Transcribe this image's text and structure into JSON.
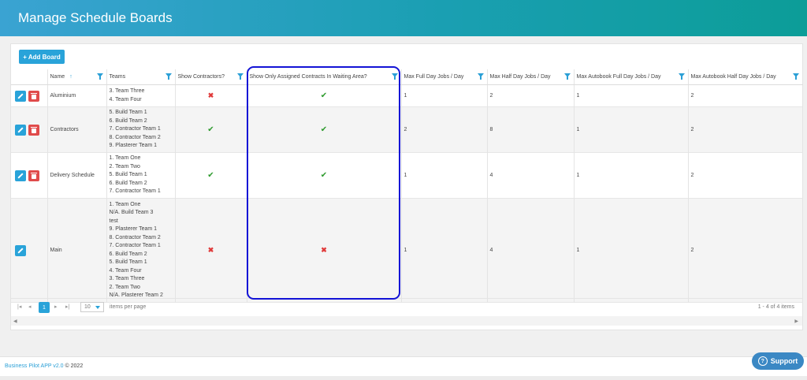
{
  "header": {
    "title": "Manage Schedule Boards"
  },
  "toolbar": {
    "add_board_label": "+ Add Board"
  },
  "columns": [
    {
      "label": ""
    },
    {
      "label": "Name",
      "sort": "↑"
    },
    {
      "label": "Teams"
    },
    {
      "label": "Show Contractors?"
    },
    {
      "label": "Show Only Assigned Contracts In Waiting Area?"
    },
    {
      "label": "Max Full Day Jobs / Day"
    },
    {
      "label": "Max Half Day Jobs / Day"
    },
    {
      "label": "Max Autobook Full Day Jobs / Day"
    },
    {
      "label": "Max Autobook Half Day Jobs / Day"
    }
  ],
  "rows": [
    {
      "name": "Aluminium",
      "teams": [
        "3. Team Three",
        "4. Team Four"
      ],
      "show_contractors": false,
      "show_assigned": true,
      "max_full": "1",
      "max_half": "2",
      "auto_full": "1",
      "auto_half": "2",
      "deletable": true
    },
    {
      "name": "Contractors",
      "teams": [
        "5. Build Team 1",
        "6. Build Team 2",
        "7. Contractor Team 1",
        "8. Contractor Team 2",
        "9. Plasterer Team 1"
      ],
      "show_contractors": true,
      "show_assigned": true,
      "max_full": "2",
      "max_half": "8",
      "auto_full": "1",
      "auto_half": "2",
      "deletable": true
    },
    {
      "name": "Delivery Schedule",
      "teams": [
        "1. Team One",
        "2. Team Two",
        "5. Build Team 1",
        "6. Build Team 2",
        "7. Contractor Team 1"
      ],
      "show_contractors": true,
      "show_assigned": true,
      "max_full": "1",
      "max_half": "4",
      "auto_full": "1",
      "auto_half": "2",
      "deletable": true
    },
    {
      "name": "Main",
      "teams": [
        "1. Team One",
        "N/A. Build Team 3",
        "test",
        "9. Plasterer Team 1",
        "8. Contractor Team 2",
        "7. Contractor Team 1",
        "6. Build Team 2",
        "5. Build Team 1",
        "4. Team Four",
        "3. Team Three",
        "2. Team Two",
        "N/A. Plasterer Team 2"
      ],
      "show_contractors": false,
      "show_assigned": false,
      "max_full": "1",
      "max_half": "4",
      "auto_full": "1",
      "auto_half": "2",
      "deletable": false
    }
  ],
  "pager": {
    "current_page": "1",
    "page_size": "10",
    "items_per_page_label": "items per page",
    "count_label": "1 - 4 of 4 items"
  },
  "footer": {
    "brand": "Business Pilot APP v2.0",
    "copyright": " © 2022"
  },
  "support": {
    "label": "Support"
  },
  "colors": {
    "accent": "#29a3d9",
    "delete": "#e04b4b",
    "check": "#2e9b2e",
    "cross": "#e03a3a",
    "highlight": "#1313d6"
  }
}
